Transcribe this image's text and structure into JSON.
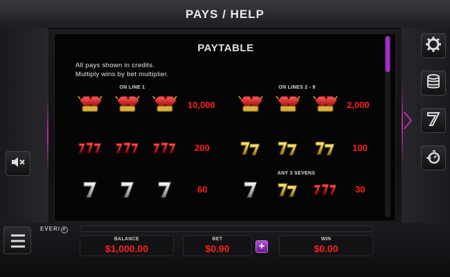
{
  "header": {
    "title": "PAYS  /  HELP"
  },
  "paytable": {
    "title": "PAYTABLE",
    "notes": [
      "All pays shown in credits.",
      "Multiply wins by bet multiplier."
    ],
    "groups": {
      "on_line_1": "ON LINE 1",
      "on_lines_2_9": "ON LINES 2 - 9",
      "any_3_sevens": "ANY 3 SEVENS"
    },
    "rows": [
      {
        "symbols": [
          "double-ruby-icon",
          "double-ruby-icon",
          "double-ruby-icon"
        ],
        "payout": "10,000"
      },
      {
        "symbols": [
          "double-ruby-icon",
          "double-ruby-icon",
          "double-ruby-icon"
        ],
        "payout": "2,000"
      },
      {
        "symbols": [
          "triple-red-seven-icon",
          "triple-red-seven-icon",
          "triple-red-seven-icon"
        ],
        "payout": "200"
      },
      {
        "symbols": [
          "double-gold-seven-icon",
          "double-gold-seven-icon",
          "double-gold-seven-icon"
        ],
        "payout": "100"
      },
      {
        "symbols": [
          "silver-seven-icon",
          "silver-seven-icon",
          "silver-seven-icon"
        ],
        "payout": "60"
      },
      {
        "symbols": [
          "silver-seven-icon",
          "double-gold-seven-icon",
          "triple-red-seven-icon"
        ],
        "payout": "30"
      }
    ]
  },
  "side_buttons": {
    "left": [
      "mute-icon"
    ],
    "right": [
      "gear-icon",
      "coin-stack-icon",
      "seven-paytable-icon",
      "replay-timer-icon"
    ]
  },
  "footer": {
    "brand": "EVERI",
    "balance_label": "BALANCE",
    "balance_value": "$1,000.00",
    "bet_label": "BET",
    "bet_value": "$0.90",
    "win_label": "WIN",
    "win_value": "$0.00",
    "plus_label": "+"
  },
  "colors": {
    "accent": "#b03ad0",
    "payout": "#ff1f1f",
    "panel": "#050505"
  }
}
